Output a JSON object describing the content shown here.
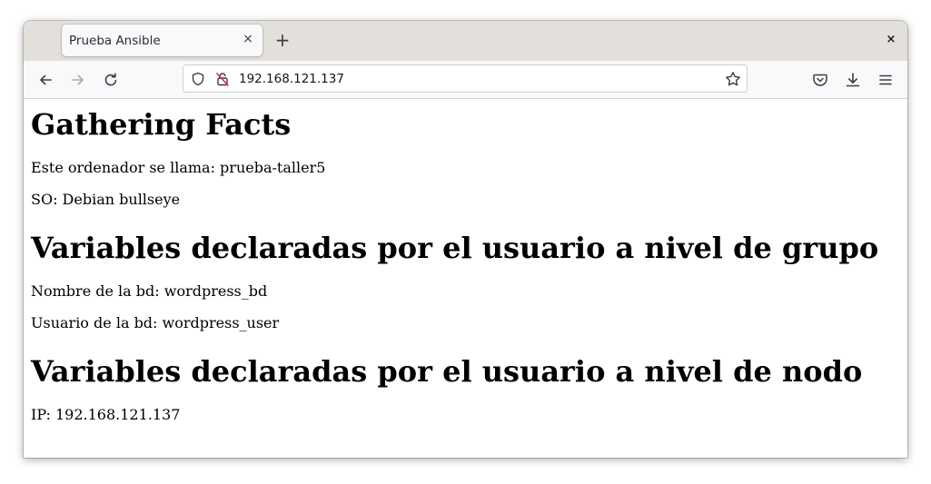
{
  "browser": {
    "tab": {
      "title": "Prueba Ansible",
      "close_glyph": "×"
    },
    "new_tab_glyph": "+",
    "window_close_glyph": "×",
    "address_bar": {
      "url": "192.168.121.137"
    },
    "icons": [
      "back-icon",
      "forward-icon",
      "reload-icon",
      "shield-icon",
      "insecure-lock-icon",
      "bookmark-star-icon",
      "pocket-icon",
      "download-icon",
      "menu-icon"
    ]
  },
  "page": {
    "section1": {
      "heading": "Gathering Facts",
      "lines": [
        "Este ordenador se llama: prueba-taller5",
        "SO: Debian bullseye"
      ]
    },
    "section2": {
      "heading": "Variables declaradas por el usuario a nivel de grupo",
      "lines": [
        "Nombre de la bd: wordpress_bd",
        "Usuario de la bd: wordpress_user"
      ]
    },
    "section3": {
      "heading": "Variables declaradas por el usuario a nivel de nodo",
      "lines": [
        "IP: 192.168.121.137"
      ]
    }
  }
}
